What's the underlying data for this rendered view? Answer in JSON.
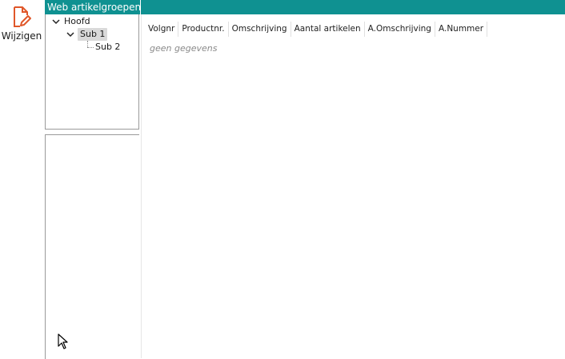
{
  "toolbar": {
    "edit_label": "Wijzigen",
    "edit_icon": "document-edit-icon",
    "accent_color": "#e0572a"
  },
  "tree_panel": {
    "title": "Web artikelgroepen",
    "header_color": "#0f9191",
    "nodes": [
      {
        "label": "Hoofd",
        "expanded": true,
        "level": 0
      },
      {
        "label": "Sub 1",
        "expanded": true,
        "level": 1,
        "selected": true
      },
      {
        "label": "Sub 2",
        "expanded": false,
        "level": 2
      }
    ]
  },
  "grid": {
    "columns": [
      "Volgnr",
      "Productnr.",
      "Omschrijving",
      "Aantal artikelen",
      "A.Omschrijving",
      "A.Nummer"
    ],
    "empty_message": "geen gegevens"
  }
}
